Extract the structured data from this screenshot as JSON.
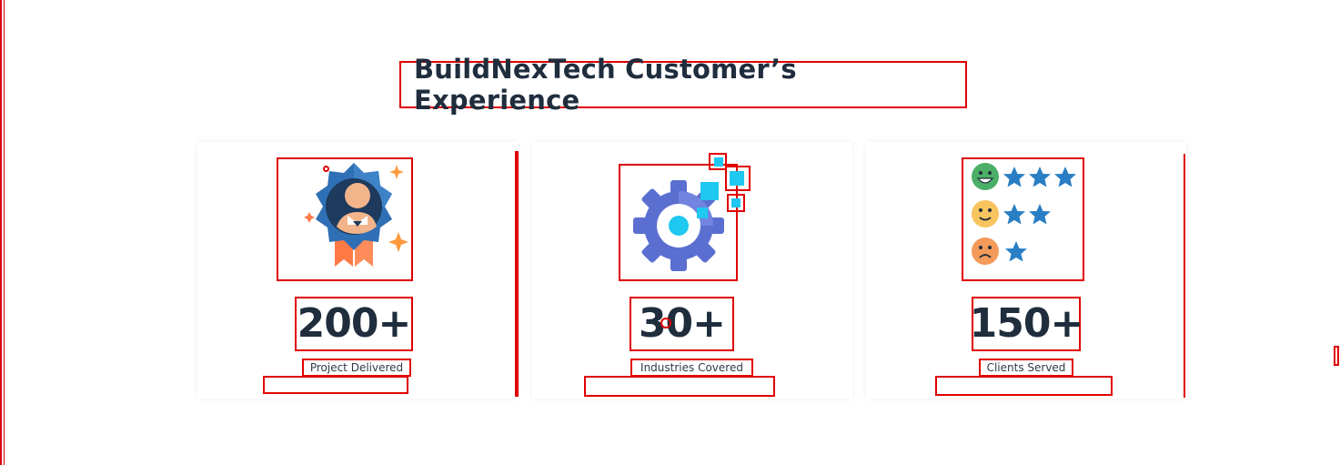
{
  "section": {
    "title": "BuildNexTech Customer’s Experience"
  },
  "stats": [
    {
      "value": "200+",
      "label": "Project Delivered",
      "icon": "award-badge-icon"
    },
    {
      "value": "30+",
      "label": "Industries Covered",
      "icon": "gear-icon"
    },
    {
      "value": "150+",
      "label": "Clients Served",
      "icon": "rating-stars-icon"
    }
  ],
  "colors": {
    "heading": "#1f2d3d",
    "annotation": "#e00000",
    "badge_blue": "#2f6fb5",
    "ribbon": "#ff7a45",
    "sparkle": "#ff9a3c",
    "gear": "#5b6fd1",
    "gear_accent": "#1ec8f0",
    "star": "#2a7fc4",
    "happy": "#4caf67",
    "neutral": "#f7c45e",
    "sad": "#f49a5a"
  }
}
